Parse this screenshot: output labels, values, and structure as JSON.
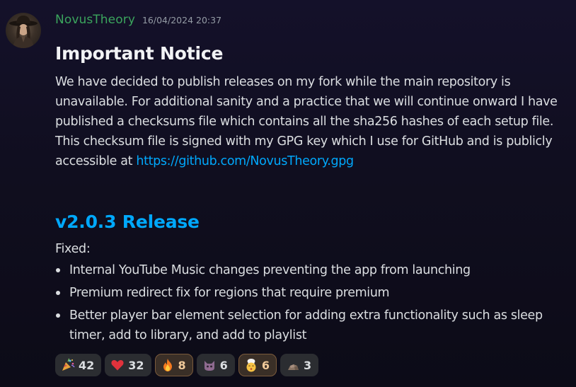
{
  "message": {
    "author": "NovusTheory",
    "timestamp": "16/04/2024 20:37",
    "author_color": "#3ba55d",
    "notice_heading": "Important Notice",
    "notice_text": "We have decided to publish releases on my fork while the main repository is unavailable. For additional sanity and a practice that we will continue onward I have published a checksums file which contains all the sha256 hashes of each setup file. This checksum file is signed with my GPG key which I use for GitHub and is publicly accessible at ",
    "notice_link": "https://github.com/NovusTheory.gpg",
    "link_color": "#00a8fc",
    "release_heading": "v2.0.3 Release",
    "fixed_label": "Fixed:",
    "fixes": [
      "Internal YouTube Music changes preventing the app from launching",
      "Premium redirect fix for regions that require premium",
      "Better player bar element selection for adding extra functionality such as sleep timer, add to library, and add to playlist"
    ]
  },
  "reactions": [
    {
      "icon": "party-popper-icon",
      "count": "42",
      "active": false
    },
    {
      "icon": "heart-icon",
      "count": "32",
      "active": false
    },
    {
      "icon": "fire-icon",
      "count": "8",
      "active": true
    },
    {
      "icon": "cat-icon",
      "count": "6",
      "active": false
    },
    {
      "icon": "chef-kiss-icon",
      "count": "6",
      "active": true
    },
    {
      "icon": "rock-icon",
      "count": "3",
      "active": false
    }
  ]
}
